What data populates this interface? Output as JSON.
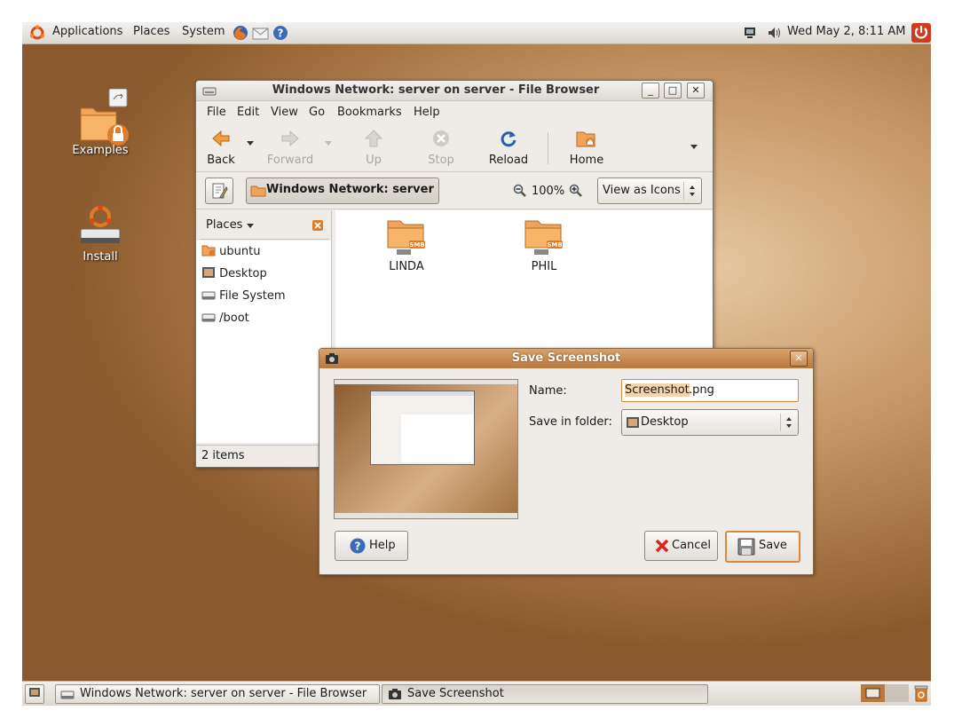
{
  "top_panel": {
    "menus": [
      "Applications",
      "Places",
      "System"
    ],
    "clock": "Wed May  2,  8:11 AM"
  },
  "desktop": {
    "icons": [
      {
        "label": "Examples"
      },
      {
        "label": "Install"
      }
    ]
  },
  "file_browser": {
    "title": "Windows Network: server on server - File Browser",
    "menu": [
      "File",
      "Edit",
      "View",
      "Go",
      "Bookmarks",
      "Help"
    ],
    "toolbar": {
      "back": "Back",
      "forward": "Forward",
      "up": "Up",
      "stop": "Stop",
      "reload": "Reload",
      "home": "Home"
    },
    "location": "Windows Network: server",
    "zoom": "100%",
    "view_mode": "View as Icons",
    "sidebar": {
      "header": "Places",
      "items": [
        "ubuntu",
        "Desktop",
        "File System",
        "/boot"
      ]
    },
    "files": [
      {
        "name": "LINDA",
        "badge": "SMB"
      },
      {
        "name": "PHIL",
        "badge": "SMB"
      }
    ],
    "status": "2 items"
  },
  "save_dialog": {
    "title": "Save Screenshot",
    "name_label": "Name:",
    "name_value_selected": "Screenshot",
    "name_value_ext": ".png",
    "folder_label": "Save in folder:",
    "folder_value": "Desktop",
    "help_label": "Help",
    "cancel_label": "Cancel",
    "save_label": "Save"
  },
  "taskbar": {
    "tasks": [
      "Windows Network: server on server - File Browser",
      "Save Screenshot"
    ]
  },
  "colors": {
    "accent_orange": "#e07b2a",
    "ubuntu_brown": "#9c6a3a",
    "selection": "#f5d3a8"
  }
}
